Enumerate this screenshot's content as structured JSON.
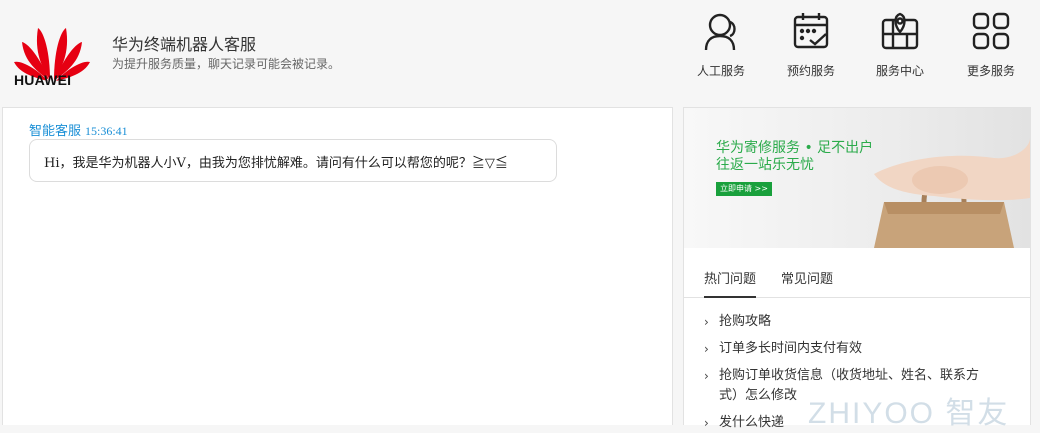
{
  "brand": {
    "logo_text": "HUAWEI",
    "logo_color": "#e60012"
  },
  "header": {
    "title": "华为终端机器人客服",
    "subtitle": "为提升服务质量，聊天记录可能会被记录。"
  },
  "nav": [
    {
      "label": "人工服务",
      "icon": "agent-icon"
    },
    {
      "label": "预约服务",
      "icon": "calendar-check-icon"
    },
    {
      "label": "服务中心",
      "icon": "map-pin-icon"
    },
    {
      "label": "更多服务",
      "icon": "grid-icon"
    }
  ],
  "chat": {
    "sender": "智能客服",
    "time": "15:36:41",
    "message": "Hi，我是华为机器人小V，由我为您排忧解难。请问有什么可以帮您的呢？≧▽≦"
  },
  "banner": {
    "title": "华为寄修服务 • 足不出户",
    "subtitle": "往返一站乐无忧",
    "button": "立即申请 >>",
    "accent": "#2bab4b"
  },
  "tabs": [
    {
      "label": "热门问题",
      "active": true
    },
    {
      "label": "常见问题",
      "active": false
    }
  ],
  "questions": [
    {
      "text": "抢购攻略"
    },
    {
      "text": "订单多长时间内支付有效"
    },
    {
      "text": "抢购订单收货信息（收货地址、姓名、联系方式）怎么修改"
    },
    {
      "text": "发什么快递"
    }
  ],
  "watermark": "ZHIYOO 智友"
}
